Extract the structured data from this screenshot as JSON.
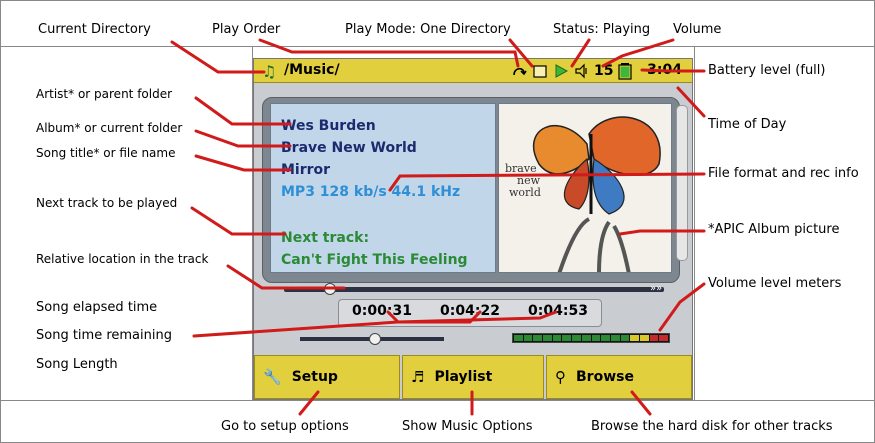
{
  "annotations": {
    "current_directory": "Current Directory",
    "play_order": "Play Order",
    "play_mode": "Play Mode: One Directory",
    "status": "Status: Playing",
    "volume": "Volume",
    "battery": "Battery level (full)",
    "time_of_day": "Time of Day",
    "artist": "Artist* or parent folder",
    "album": "Album* or current folder",
    "song_title": "Song title* or file name",
    "file_format": "File format and rec info",
    "next_track": "Next track to be played",
    "apic": "*APIC Album picture",
    "relative_location": "Relative location in the track",
    "volume_meters": "Volume level meters",
    "elapsed": "Song elapsed time",
    "remaining": "Song time remaining",
    "length": "Song Length",
    "setup_desc": "Go to setup options",
    "playlist_desc": "Show Music Options",
    "browse_desc": "Browse the hard disk for other tracks"
  },
  "screen": {
    "directory": "/Music/",
    "volume_level": "15",
    "clock": "3:04",
    "artist": "Wes Burden",
    "album": "Brave New World",
    "title": "Mirror",
    "format": "MP3 128 kb/s 44.1 kHz",
    "next_label": "Next track:",
    "next_title": "Can't Fight This Feeling",
    "elapsed": "0:00:31",
    "remaining": "0:04:22",
    "length": "0:04:53",
    "track_position_fraction": 0.11,
    "volume_fraction": 0.52,
    "battery_fraction": 1.0
  },
  "album_art": {
    "text_line1": "brave",
    "text_line2": "new",
    "text_line3": "world"
  },
  "buttons": {
    "setup": "Setup",
    "playlist": "Playlist",
    "browse": "Browse"
  },
  "icons": {
    "directory": "music-note-icon",
    "play_order": "repeat-icon",
    "play_mode": "folder-icon",
    "status": "play-icon",
    "volume": "speaker-icon",
    "battery": "battery-icon",
    "setup": "wrench-icon",
    "playlist": "playlist-icon",
    "browse": "magnifier-icon"
  },
  "colors": {
    "bar_yellow": "#e2cf3e",
    "info_navy": "#1c2a6e",
    "info_blue": "#2f8fd6",
    "info_green": "#2a8a35",
    "leader_red": "#d11a1a"
  }
}
